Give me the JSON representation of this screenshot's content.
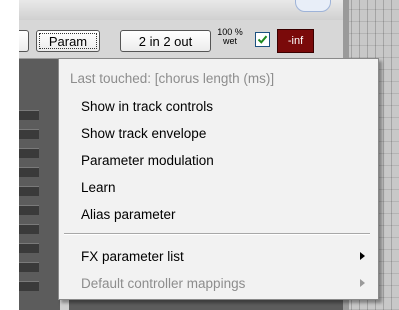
{
  "toolbar": {
    "param_label": "Param",
    "io_label": "2 in 2 out",
    "wet_percent": "100 %",
    "wet_label": "wet",
    "wet_checked": true,
    "level_label": "-inf"
  },
  "menu": {
    "header": "Last touched: [chorus length (ms)]",
    "items": [
      {
        "label": "Show in track controls",
        "enabled": true
      },
      {
        "label": "Show track envelope",
        "enabled": true
      },
      {
        "label": "Parameter modulation",
        "enabled": true
      },
      {
        "label": "Learn",
        "enabled": true
      },
      {
        "label": "Alias parameter",
        "enabled": true
      }
    ],
    "submenus": [
      {
        "label": "FX parameter list",
        "enabled": true
      },
      {
        "label": "Default controller mappings",
        "enabled": false
      }
    ]
  },
  "colors": {
    "menu_bg": "#f2f2f2",
    "disabled_text": "#8d8d8d",
    "level_button": "#7a0a0a"
  }
}
